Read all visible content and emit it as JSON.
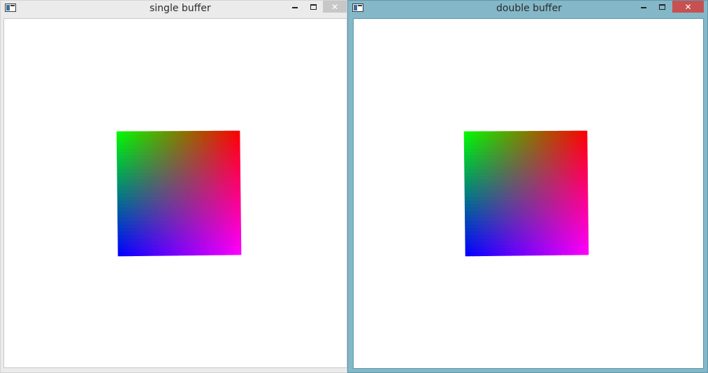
{
  "windows": [
    {
      "id": "single",
      "title": "single buffer",
      "buttons": {
        "minimize_icon": "minimize-icon",
        "maximize_icon": "maximize-icon",
        "close_label": "✕"
      },
      "close_color": "#c7c7c7",
      "frame_color": "#ebebeb"
    },
    {
      "id": "double",
      "title": "double buffer",
      "buttons": {
        "minimize_icon": "minimize-icon",
        "maximize_icon": "maximize-icon",
        "close_label": "✕"
      },
      "close_color": "#c75050",
      "frame_color": "#84b8c8"
    }
  ],
  "quad_colors": {
    "top_left": "#00ff00",
    "top_right": "#ff0000",
    "bottom_left": "#0000ff",
    "bottom_right": "#ff00ff"
  }
}
